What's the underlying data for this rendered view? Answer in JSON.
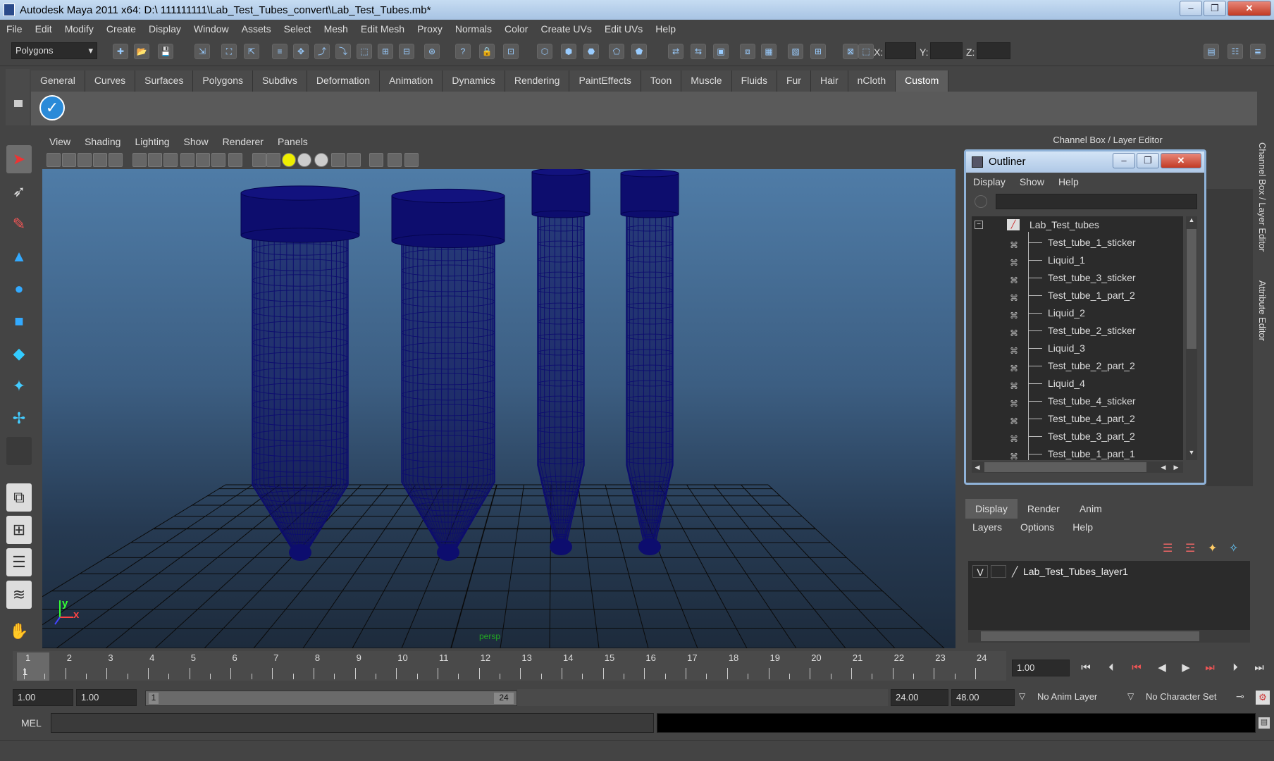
{
  "window": {
    "title": "Autodesk Maya 2011 x64: D:\\ 111111111\\Lab_Test_Tubes_convert\\Lab_Test_Tubes.mb*"
  },
  "menubar": [
    "File",
    "Edit",
    "Modify",
    "Create",
    "Display",
    "Window",
    "Assets",
    "Select",
    "Mesh",
    "Edit Mesh",
    "Proxy",
    "Normals",
    "Color",
    "Create UVs",
    "Edit UVs",
    "Help"
  ],
  "toolbar": {
    "mode": "Polygons",
    "x_label": "X:",
    "y_label": "Y:",
    "z_label": "Z:"
  },
  "shelf_tabs": [
    "General",
    "Curves",
    "Surfaces",
    "Polygons",
    "Subdivs",
    "Deformation",
    "Animation",
    "Dynamics",
    "Rendering",
    "PaintEffects",
    "Toon",
    "Muscle",
    "Fluids",
    "Fur",
    "Hair",
    "nCloth",
    "Custom"
  ],
  "shelf_active": "Custom",
  "viewport": {
    "menu": [
      "View",
      "Shading",
      "Lighting",
      "Show",
      "Renderer",
      "Panels"
    ],
    "camera_label": "persp",
    "axis_y": "y",
    "axis_x": "x",
    "wire_color": "#0d0d6e"
  },
  "channel_box_title": "Channel Box / Layer Editor",
  "outliner": {
    "title": "Outliner",
    "menu": [
      "Display",
      "Show",
      "Help"
    ],
    "root": "Lab_Test_tubes",
    "items": [
      "Test_tube_1_sticker",
      "Liquid_1",
      "Test_tube_3_sticker",
      "Test_tube_1_part_2",
      "Liquid_2",
      "Test_tube_2_sticker",
      "Liquid_3",
      "Test_tube_2_part_2",
      "Liquid_4",
      "Test_tube_4_sticker",
      "Test_tube_4_part_2",
      "Test_tube_3_part_2",
      "Test_tube_1_part_1"
    ]
  },
  "layers": {
    "tabs": [
      "Display",
      "Render",
      "Anim"
    ],
    "active_tab": "Display",
    "menu": [
      "Layers",
      "Options",
      "Help"
    ],
    "rows": [
      {
        "visible": "V",
        "name": "Lab_Test_Tubes_layer1"
      }
    ]
  },
  "side_tabs": [
    "Channel Box / Layer Editor",
    "Attribute Editor"
  ],
  "timeline": {
    "frames": [
      "1",
      "2",
      "3",
      "4",
      "5",
      "6",
      "7",
      "8",
      "9",
      "10",
      "11",
      "12",
      "13",
      "14",
      "15",
      "16",
      "17",
      "18",
      "19",
      "20",
      "21",
      "22",
      "23",
      "24"
    ],
    "current_frame": "1",
    "current_time": "1.00"
  },
  "range": {
    "start": "1.00",
    "playback_start": "1.00",
    "range_start": "1",
    "range_end": "24",
    "playback_end": "24.00",
    "end": "48.00",
    "anim_layer": "No Anim Layer",
    "character_set": "No Character Set"
  },
  "mel": {
    "label": "MEL"
  }
}
